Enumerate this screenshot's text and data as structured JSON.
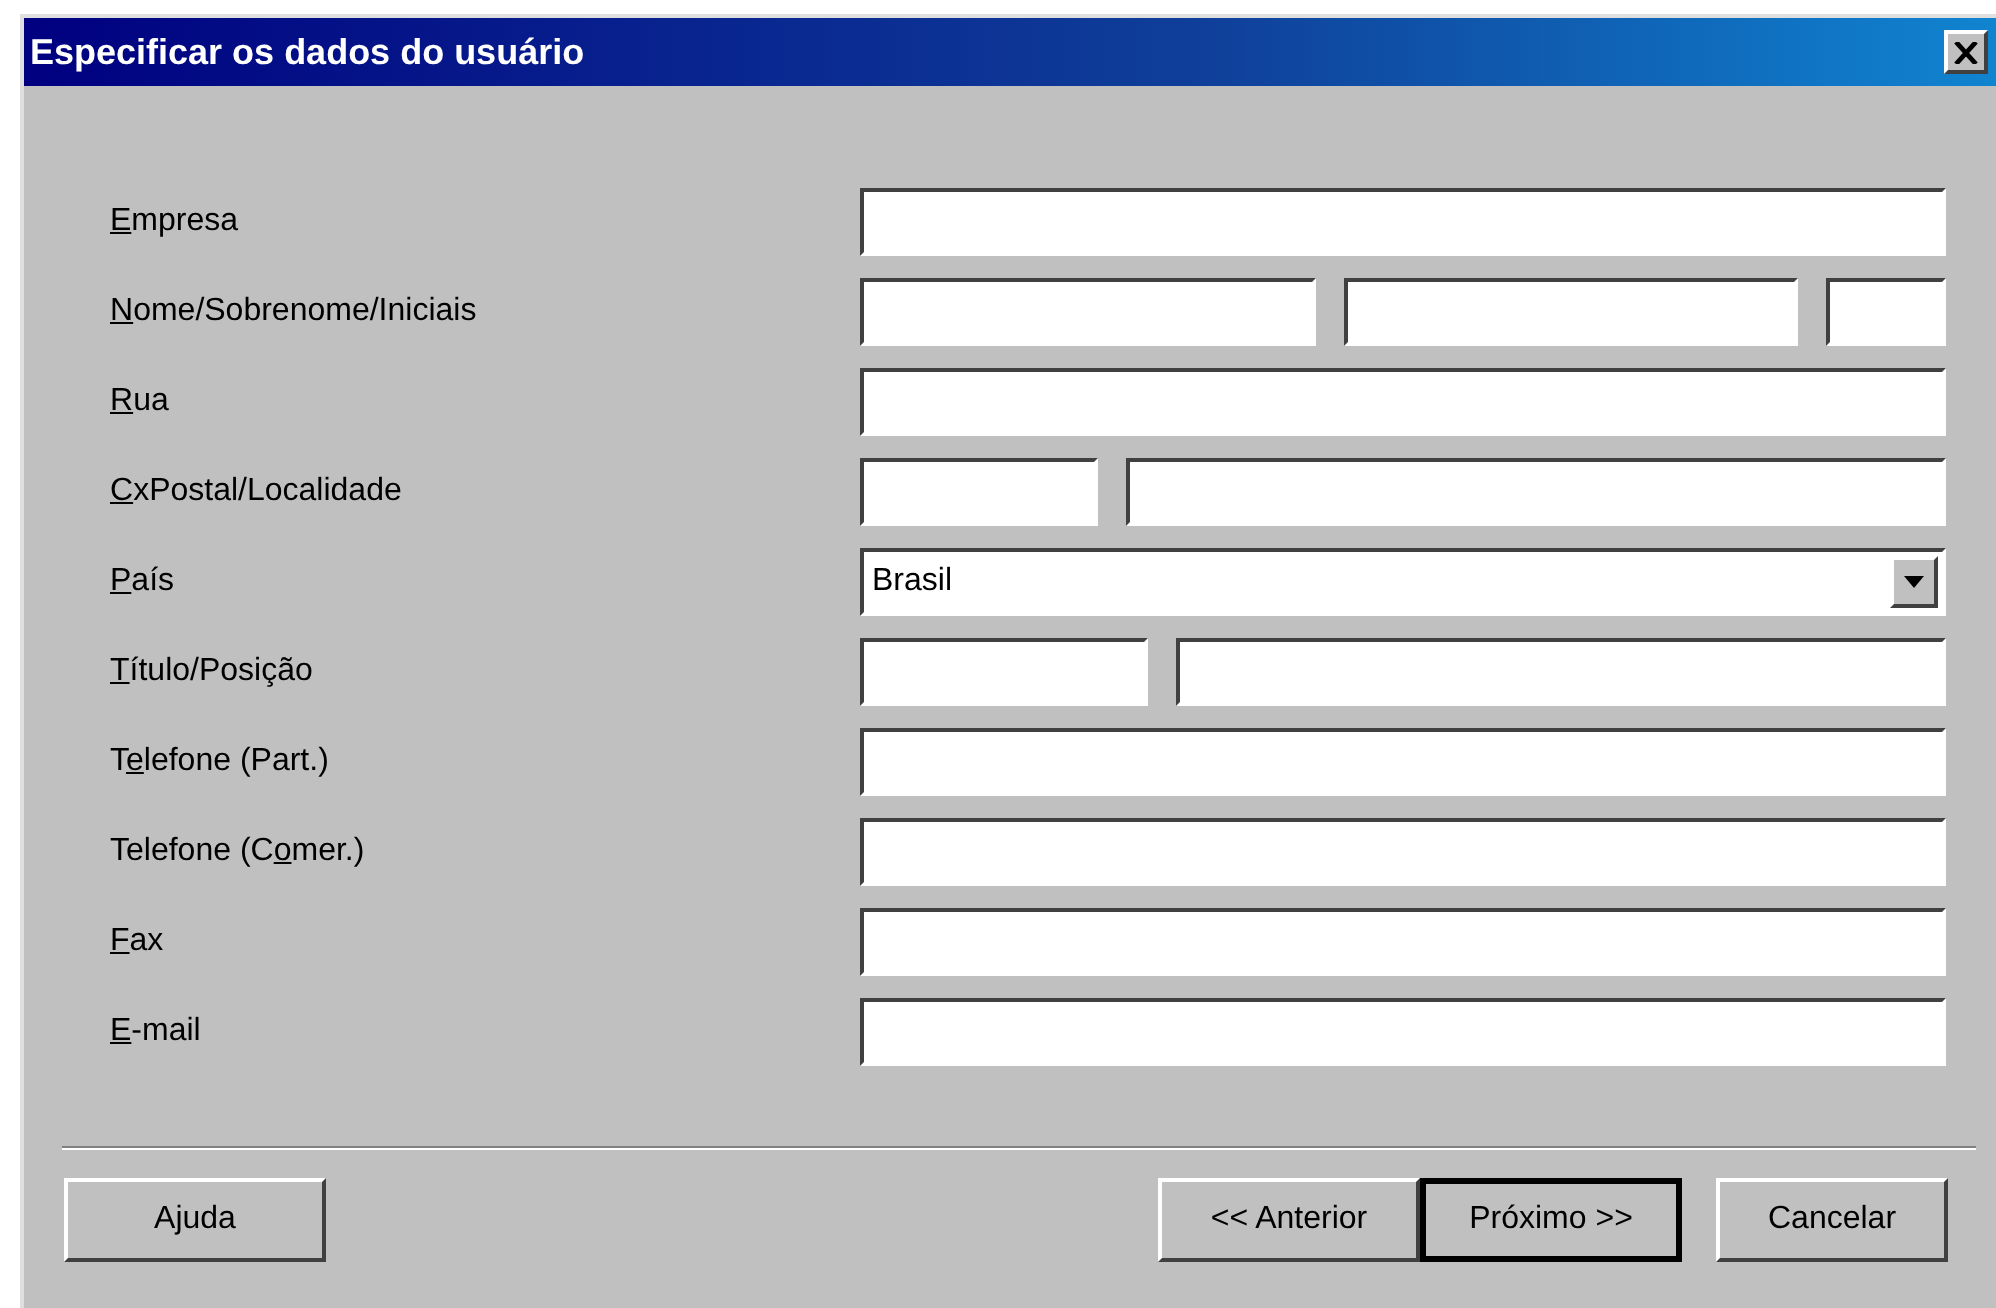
{
  "window": {
    "title": "Especificar os dados do usuário"
  },
  "rows": [
    {
      "label": {
        "key": "E",
        "post": "mpresa"
      },
      "fields": [
        {
          "kind": "text"
        }
      ]
    },
    {
      "label": {
        "key": "N",
        "post": "ome/Sobrenome/Iniciais"
      },
      "fields": [
        {
          "kind": "text"
        },
        {
          "kind": "text"
        },
        {
          "kind": "text"
        }
      ]
    },
    {
      "label": {
        "key": "R",
        "post": "ua"
      },
      "fields": [
        {
          "kind": "text"
        }
      ]
    },
    {
      "label": {
        "key": "C",
        "post": "xPostal/Localidade"
      },
      "fields": [
        {
          "kind": "text"
        },
        {
          "kind": "text"
        }
      ]
    },
    {
      "label": {
        "key": "P",
        "post": "aís"
      },
      "fields": [
        {
          "kind": "select",
          "value": "Brasil"
        }
      ]
    },
    {
      "label": {
        "key": "T",
        "post": "ítulo/Posição"
      },
      "fields": [
        {
          "kind": "text"
        },
        {
          "kind": "text"
        }
      ]
    },
    {
      "label": {
        "pre": "T",
        "key": "e",
        "post": "lefone (Part.)"
      },
      "fields": [
        {
          "kind": "text"
        }
      ]
    },
    {
      "label": {
        "pre": "Telefone (C",
        "key": "o",
        "post": "mer.)"
      },
      "fields": [
        {
          "kind": "text"
        }
      ]
    },
    {
      "label": {
        "key": "F",
        "post": "ax"
      },
      "fields": [
        {
          "kind": "text"
        }
      ]
    },
    {
      "label": {
        "key": "E",
        "post": "-mail"
      },
      "fields": [
        {
          "kind": "text"
        }
      ]
    }
  ],
  "buttons_left": [
    {
      "label": "Ajuda",
      "default": false
    }
  ],
  "buttons_right": [
    {
      "label": "<< Anterior",
      "default": false
    },
    {
      "label": "Próximo >>",
      "default": true
    },
    {
      "label": "Cancelar",
      "default": false
    }
  ]
}
